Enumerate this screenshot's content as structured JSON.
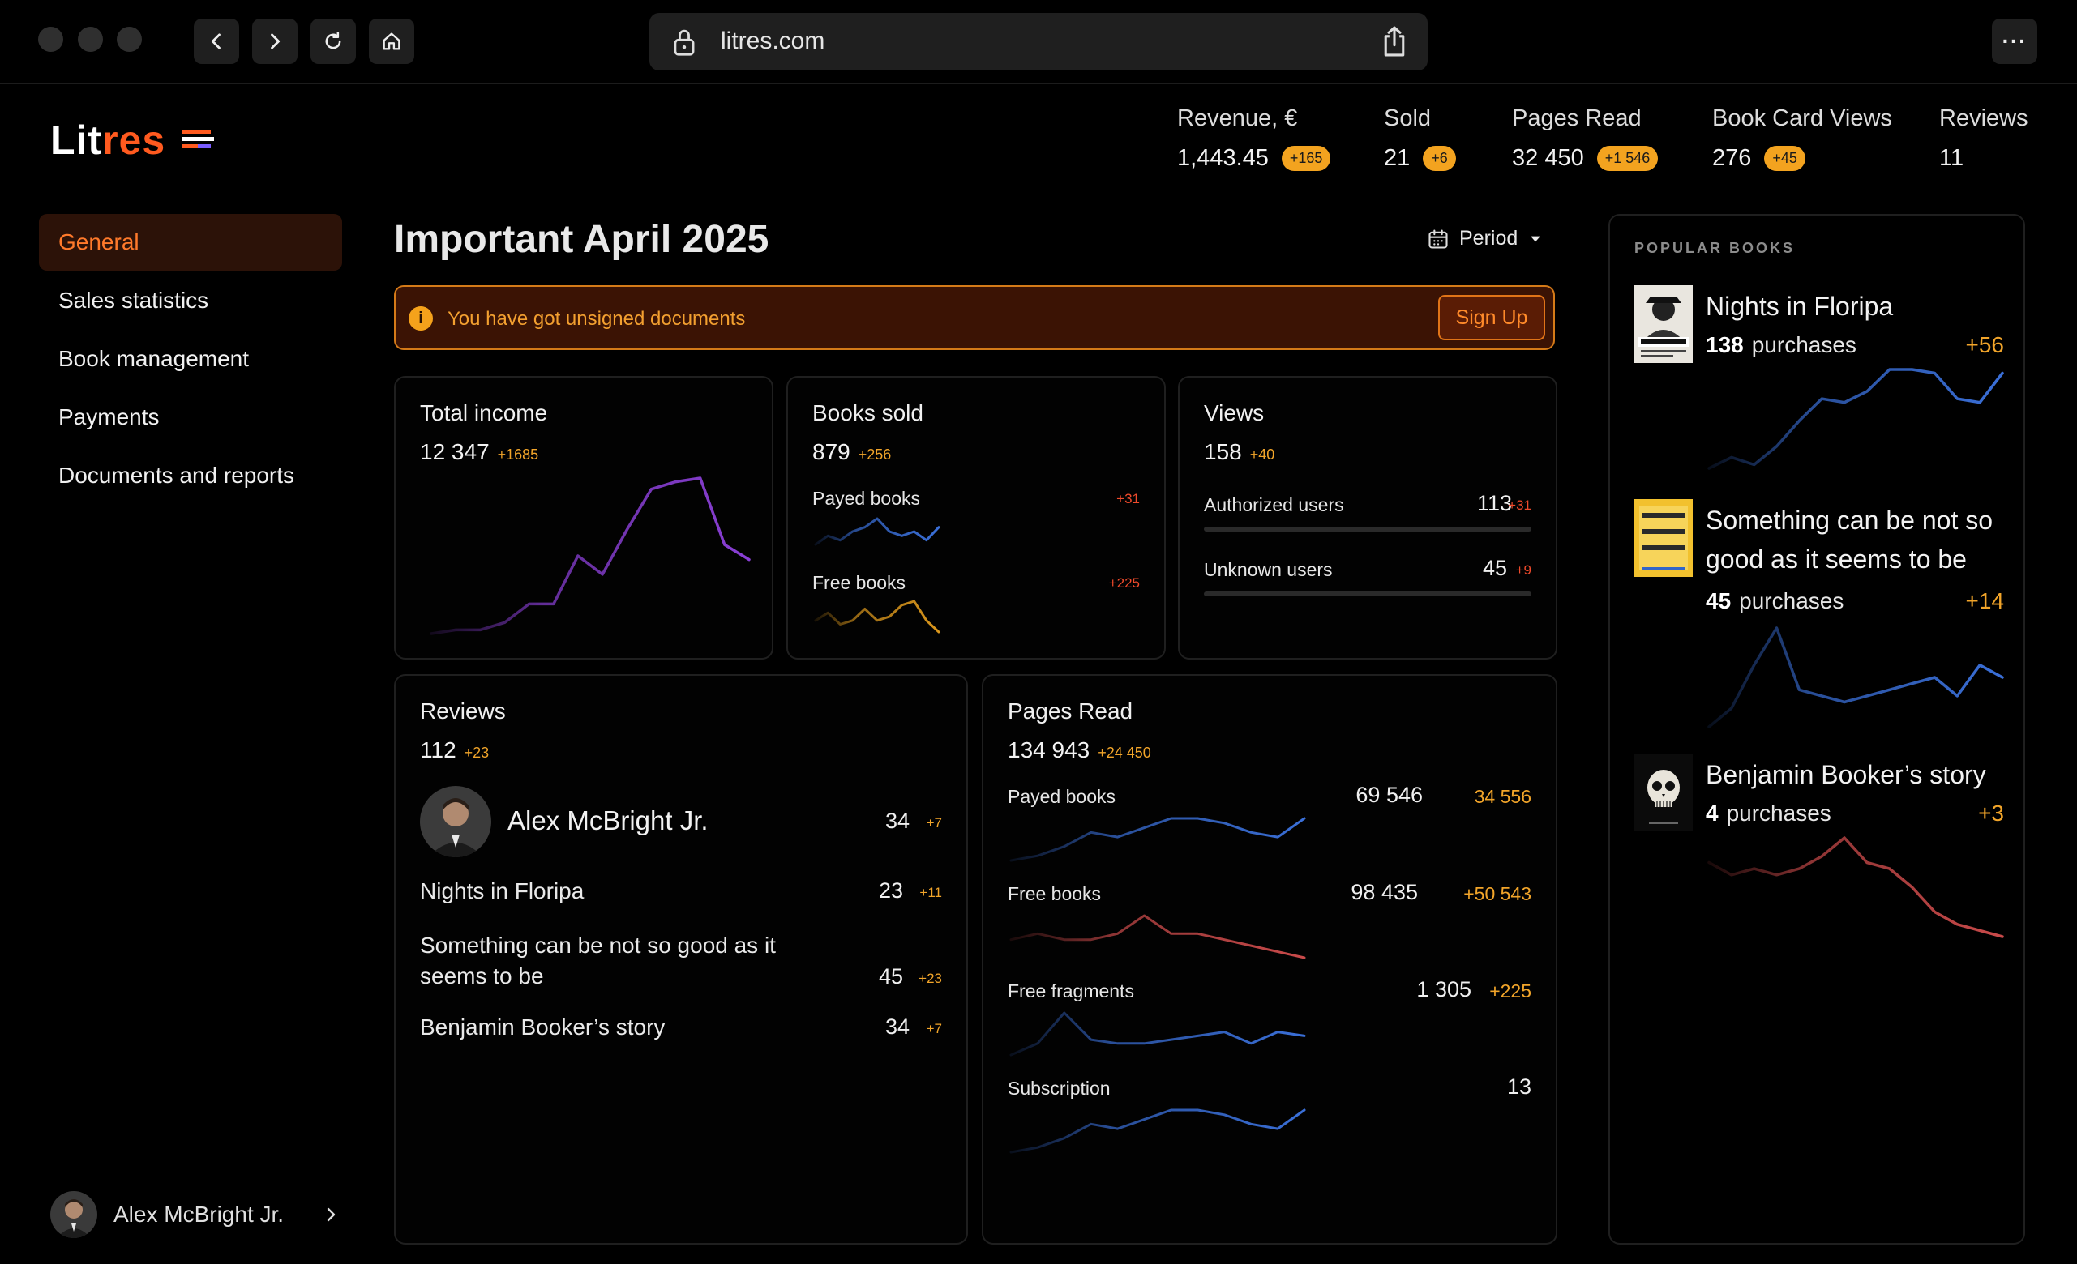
{
  "browser": {
    "url": "litres.com"
  },
  "logo": {
    "left": "Lit",
    "right": "res"
  },
  "top_stats": [
    {
      "label": "Revenue, €",
      "value": "1,443.45",
      "delta": "+165"
    },
    {
      "label": "Sold",
      "value": "21",
      "delta": "+6"
    },
    {
      "label": "Pages Read",
      "value": "32 450",
      "delta": "+1 546"
    },
    {
      "label": "Book Card Views",
      "value": "276",
      "delta": "+45"
    },
    {
      "label": "Reviews",
      "value": "11",
      "delta": ""
    }
  ],
  "sidebar": {
    "items": [
      {
        "label": "General",
        "active": true
      },
      {
        "label": "Sales statistics"
      },
      {
        "label": "Book management"
      },
      {
        "label": "Payments"
      },
      {
        "label": "Documents and reports"
      }
    ],
    "user_name": "Alex McBright Jr."
  },
  "main": {
    "title": "Important April 2025",
    "period_label": "Period",
    "alert": {
      "message": "You have got unsigned documents",
      "button": "Sign Up"
    }
  },
  "income": {
    "title": "Total income",
    "value": "12 347",
    "delta": "+1685",
    "series": [
      2,
      3,
      3,
      5,
      10,
      10,
      23,
      18,
      30,
      41,
      43,
      44,
      26,
      22
    ],
    "color": "#8a3fd6"
  },
  "sold": {
    "title": "Books sold",
    "value": "879",
    "delta": "+256",
    "payed": {
      "label": "Payed books",
      "delta": "+31",
      "series": [
        3,
        5,
        4,
        6,
        7,
        9,
        6,
        5,
        6,
        4,
        7
      ],
      "color": "#3a6fd8"
    },
    "free": {
      "label": "Free books",
      "delta": "+225",
      "series": [
        5,
        7,
        4,
        5,
        8,
        5,
        6,
        9,
        10,
        5,
        2
      ],
      "color": "#d9961c"
    }
  },
  "views": {
    "title": "Views",
    "value": "158",
    "delta": "+40",
    "authorized": {
      "label": "Authorized users",
      "value": "113",
      "delta": "+31",
      "primary_share": 0.33,
      "secondary_share": 0.11
    },
    "unknown": {
      "label": "Unknown users",
      "value": "45",
      "delta": "+9",
      "primary_share": 0.14,
      "secondary_share": 0.08
    }
  },
  "reviews": {
    "title": "Reviews",
    "value": "112",
    "delta": "+23",
    "author": {
      "name": "Alex McBright Jr.",
      "value": "34",
      "delta": "+7"
    },
    "books": [
      {
        "title": "Nights in Floripa",
        "value": "23",
        "delta": "+11"
      },
      {
        "title": "Something can be not so good as it seems to be",
        "value": "45",
        "delta": "+23"
      },
      {
        "title": "Benjamin Booker’s story",
        "value": "34",
        "delta": "+7"
      }
    ]
  },
  "pages": {
    "title": "Pages Read",
    "value": "134 943",
    "delta": "+24 450",
    "rows": [
      {
        "label": "Payed books",
        "value": "69 546",
        "delta": "34 556",
        "color": "#3a6fd8",
        "series": [
          2,
          3,
          5,
          8,
          7,
          9,
          11,
          11,
          10,
          8,
          7,
          11
        ]
      },
      {
        "label": "Free books",
        "value": "98 435",
        "delta": "+50 543",
        "color": "#c94a4a",
        "series": [
          6,
          7,
          6,
          6,
          7,
          10,
          7,
          7,
          6,
          5,
          4,
          3
        ]
      },
      {
        "label": "Free fragments",
        "value": "1 305",
        "delta": "+225",
        "color": "#3a6fd8",
        "series": [
          3,
          6,
          14,
          7,
          6,
          6,
          7,
          8,
          9,
          6,
          9,
          8
        ]
      },
      {
        "label": "Subscription",
        "value": "13",
        "delta": "",
        "color": "#3a6fd8",
        "series": [
          2,
          3,
          5,
          8,
          7,
          9,
          11,
          11,
          10,
          8,
          7,
          11
        ]
      }
    ]
  },
  "popular": {
    "heading": "POPULAR BOOKS",
    "books": [
      {
        "title": "Nights in Floripa",
        "purchases": "138",
        "purchases_label": "purchases",
        "delta": "+56",
        "color": "#3a6fd8",
        "series": [
          7,
          10,
          8,
          13,
          20,
          26,
          25,
          28,
          34,
          34,
          33,
          26,
          25,
          33
        ]
      },
      {
        "title": "Something can be not so good as it seems to be",
        "purchases": "45",
        "purchases_label": "purchases",
        "delta": "+14",
        "color": "#3a6fd8",
        "series": [
          2,
          5,
          12,
          18,
          8,
          7,
          6,
          7,
          8,
          9,
          10,
          7,
          12,
          10
        ]
      },
      {
        "title": "Benjamin Booker’s story",
        "purchases": "4",
        "purchases_label": "purchases",
        "delta": "+3",
        "color": "#c94a4a",
        "series": [
          12,
          10,
          11,
          10,
          11,
          13,
          16,
          12,
          11,
          8,
          4,
          2,
          1,
          0
        ]
      }
    ]
  }
}
